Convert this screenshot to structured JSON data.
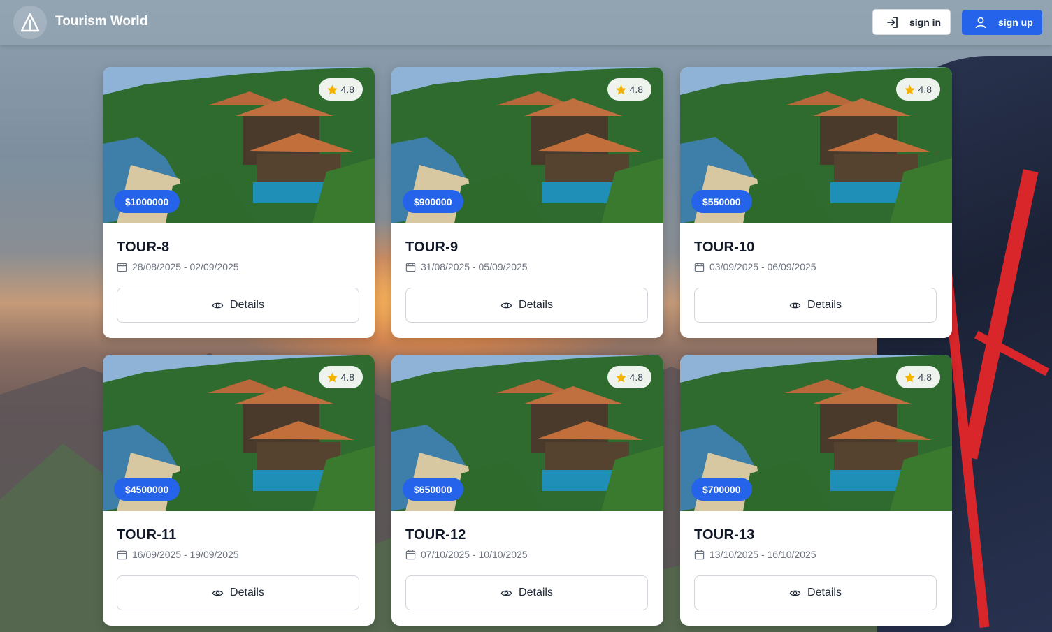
{
  "header": {
    "brand": "Tourism World",
    "sign_in_label": "sign in",
    "sign_up_label": "sign up"
  },
  "tours": [
    {
      "title": "TOUR-8",
      "dates": "28/08/2025 - 02/09/2025",
      "price": "$1000000",
      "rating": "4.8",
      "details_label": "Details"
    },
    {
      "title": "TOUR-9",
      "dates": "31/08/2025 - 05/09/2025",
      "price": "$900000",
      "rating": "4.8",
      "details_label": "Details"
    },
    {
      "title": "TOUR-10",
      "dates": "03/09/2025 - 06/09/2025",
      "price": "$550000",
      "rating": "4.8",
      "details_label": "Details"
    },
    {
      "title": "TOUR-11",
      "dates": "16/09/2025 - 19/09/2025",
      "price": "$4500000",
      "rating": "4.8",
      "details_label": "Details"
    },
    {
      "title": "TOUR-12",
      "dates": "07/10/2025 - 10/10/2025",
      "price": "$650000",
      "rating": "4.8",
      "details_label": "Details"
    },
    {
      "title": "TOUR-13",
      "dates": "13/10/2025 - 16/10/2025",
      "price": "$700000",
      "rating": "4.8",
      "details_label": "Details"
    }
  ],
  "icons": {
    "logo": "triangle-logo-icon",
    "sign_in": "login-arrow-icon",
    "sign_up": "user-icon",
    "rating": "star-icon",
    "dates": "calendar-icon",
    "details": "eye-icon"
  },
  "colors": {
    "accent": "#2563eb",
    "star": "#f5b301"
  }
}
